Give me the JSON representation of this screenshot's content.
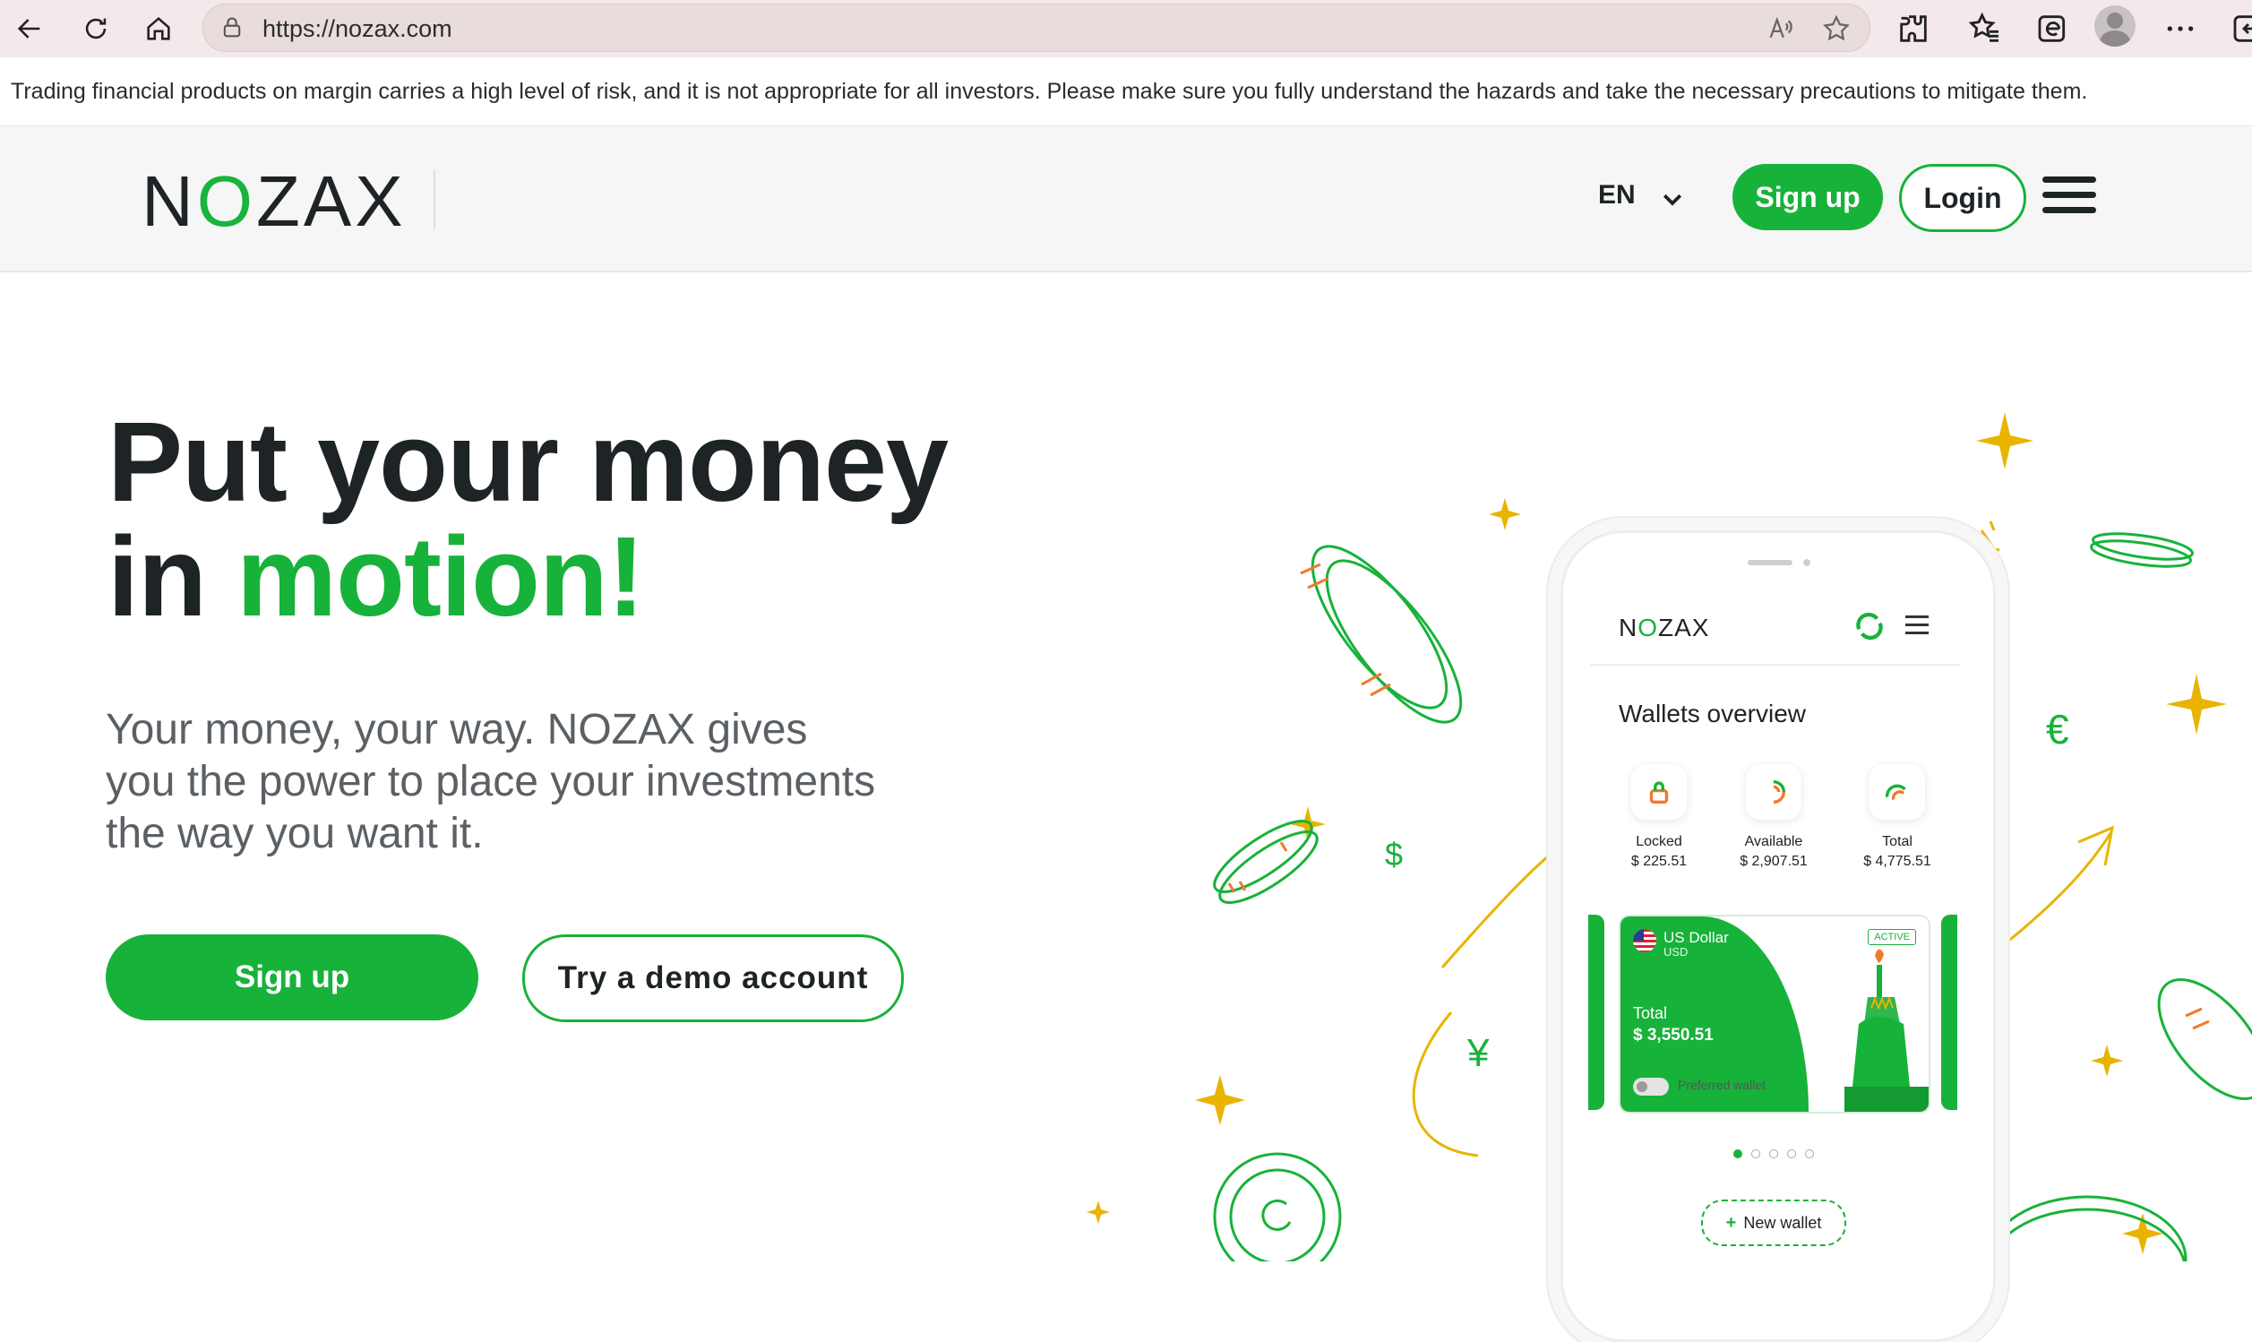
{
  "browser": {
    "url": "https://nozax.com",
    "icons": [
      "back-arrow-icon",
      "refresh-icon",
      "home-icon",
      "lock-icon",
      "read-aloud-icon",
      "favorite-star-icon",
      "extensions-icon",
      "favorites-icon",
      "edge-collections-icon",
      "profile-icon",
      "more-icon"
    ]
  },
  "risk_banner": {
    "text": "Trading financial products on margin carries a high level of risk, and it is not appropriate for all investors. Please make sure you fully understand the hazards and take the necessary precautions to mitigate them."
  },
  "header": {
    "logo": {
      "part1": "N",
      "o": "O",
      "part2": "ZAX"
    },
    "language": "EN",
    "signup_label": "Sign up",
    "login_label": "Login"
  },
  "hero": {
    "title_line1": "Put your money",
    "title_line2_plain": "in ",
    "title_line2_accent": "motion!",
    "subtitle": "Your money, your way. NOZAX gives you the power to place your investments the way you want it.",
    "signup_label": "Sign up",
    "demo_label": "Try a demo account"
  },
  "phone": {
    "logo": {
      "part1": "N",
      "o": "O",
      "part2": "ZAX"
    },
    "section_title": "Wallets overview",
    "stats": [
      {
        "label": "Locked",
        "value": "$ 225.51"
      },
      {
        "label": "Available",
        "value": "$ 2,907.51"
      },
      {
        "label": "Total",
        "value": "$ 4,775.51"
      }
    ],
    "wallet_card": {
      "currency": "US Dollar",
      "code": "USD",
      "status": "ACTIVE",
      "total_label": "Total",
      "total_value": "$ 3,550.51",
      "preferred_label": "Preferred wallet"
    },
    "carousel_active_index": 0,
    "new_wallet_label": "New wallet"
  },
  "colors": {
    "brand_green": "#17b23a",
    "accent_gold": "#e8b400",
    "text_dark": "#1e2326"
  }
}
